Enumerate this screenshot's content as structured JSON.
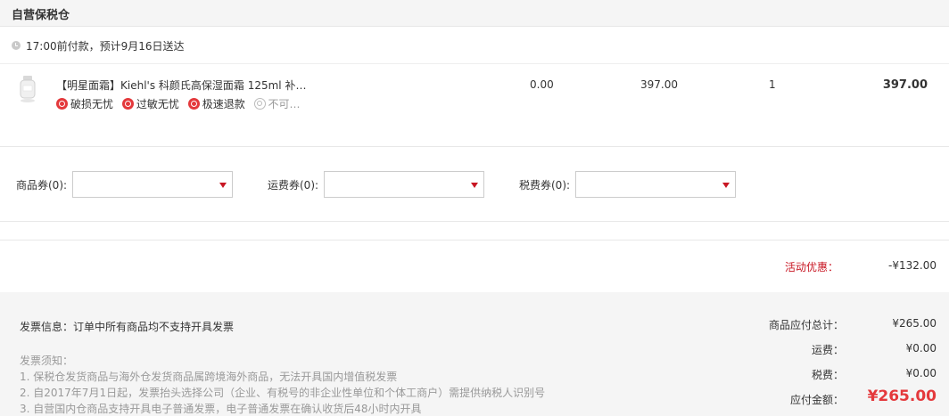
{
  "section": {
    "title": "自营保税仓"
  },
  "delivery": {
    "text": "17:00前付款，预计9月16日送达"
  },
  "item": {
    "name": "【明星面霜】Kiehl's 科颜氏高保湿面霜 125ml 补…",
    "badges": [
      {
        "label": "破损无忧",
        "enabled": true
      },
      {
        "label": "过敏无忧",
        "enabled": true
      },
      {
        "label": "极速退款",
        "enabled": true
      },
      {
        "label": "不可…",
        "enabled": false
      }
    ],
    "tax": "0.00",
    "price": "397.00",
    "quantity": "1",
    "subtotal": "397.00"
  },
  "coupons": {
    "goods_label": "商品券(0):",
    "shipping_label": "运费券(0):",
    "tax_label": "税费券(0):"
  },
  "promotion": {
    "label": "活动优惠：",
    "value": "-¥132.00"
  },
  "invoice": {
    "info": "发票信息：订单中所有商品均不支持开具发票",
    "notice_title": "发票须知：",
    "notices": [
      "1. 保税仓发货商品与海外仓发货商品属跨境海外商品，无法开具国内增值税发票",
      "2. 自2017年7月1日起，发票抬头选择公司（企业、有税号的非企业性单位和个体工商户）需提供纳税人识别号",
      "3. 自营国内仓商品支持开具电子普通发票，电子普通发票在确认收货后48小时内开具"
    ]
  },
  "summary": {
    "goods_total_label": "商品应付总计：",
    "goods_total_value": "¥265.00",
    "shipping_label": "运费：",
    "shipping_value": "¥0.00",
    "tax_label": "税费：",
    "tax_value": "¥0.00",
    "payable_label": "应付金额：",
    "payable_value": "¥265.00"
  },
  "colors": {
    "accent": "#e4393c",
    "promo": "#c81623",
    "footer_bg": "#f5f5f5"
  },
  "icons": {
    "clock": "clock-icon",
    "badge": "shield-icon",
    "dropdown": "dropdown-arrow-icon"
  }
}
